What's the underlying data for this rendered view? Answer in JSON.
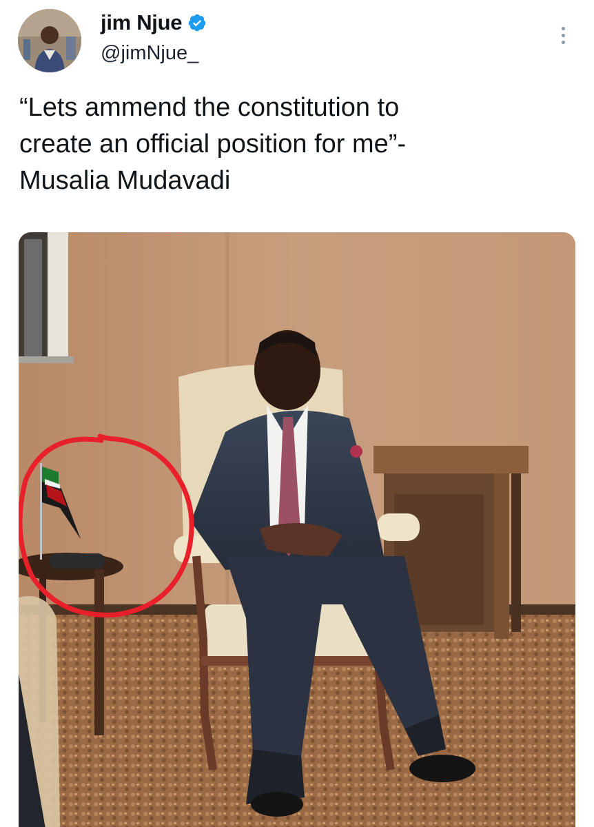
{
  "author": {
    "display_name": "jim Njue",
    "handle": "@jimNjue_",
    "verified": true,
    "verified_icon": "verified-badge-icon",
    "badge_color": "#1d9bf0"
  },
  "more_icon": "more-vertical-icon",
  "tweet": {
    "text": "“Lets ammend the constitution to\ncreate an official position for me”-\nMusalia Mudavadi"
  },
  "media": {
    "type": "photo",
    "highlight_color": "#e8202a"
  }
}
